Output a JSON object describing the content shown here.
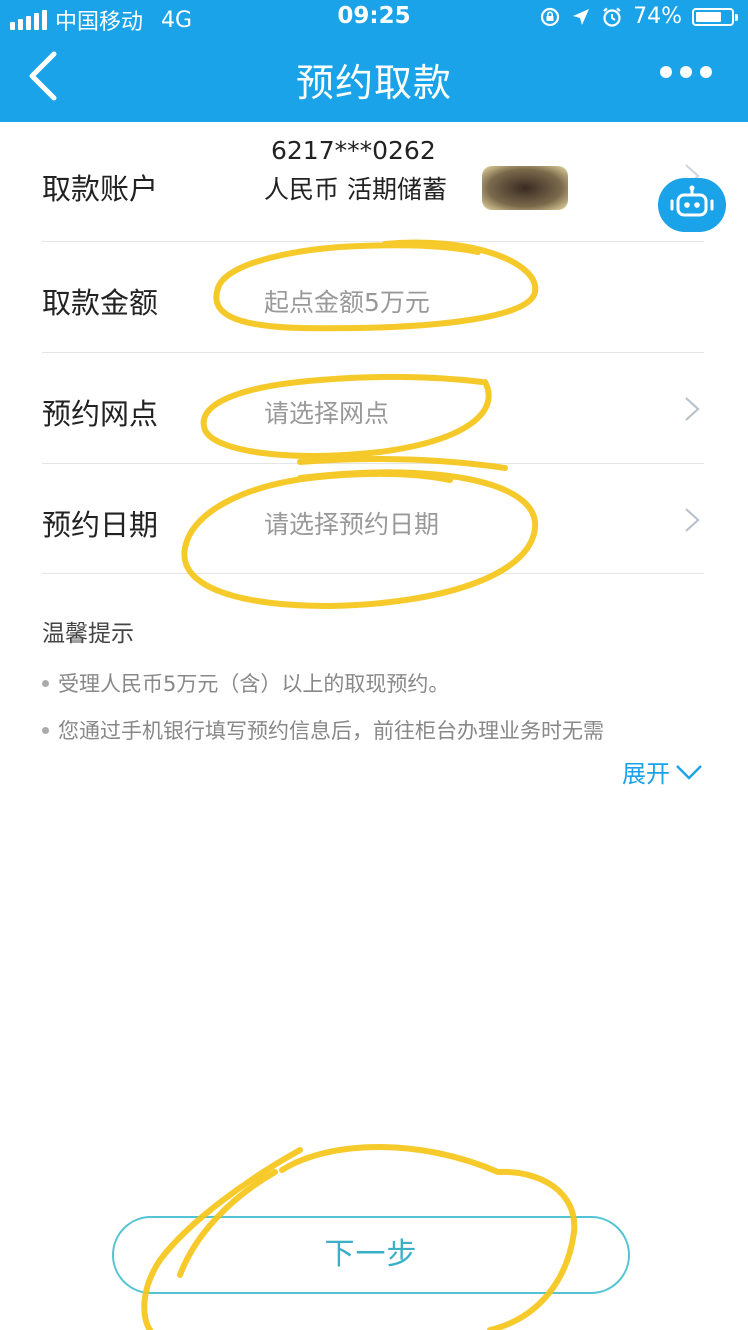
{
  "status_bar": {
    "carrier": "中国移动",
    "network": "4G",
    "time": "09:25",
    "battery": "74%",
    "battery_level": 0.74
  },
  "nav": {
    "title": "预约取款"
  },
  "form": {
    "account": {
      "label": "取款账户",
      "number": "6217***0262",
      "type": "人民币 活期储蓄"
    },
    "amount": {
      "label": "取款金额",
      "placeholder": "起点金额5万元"
    },
    "branch": {
      "label": "预约网点",
      "placeholder": "请选择网点"
    },
    "date": {
      "label": "预约日期",
      "placeholder": "请选择预约日期"
    }
  },
  "tips": {
    "title": "温馨提示",
    "items": [
      "受理人民币5万元（含）以上的取现预约。",
      "您通过手机银行填写预约信息后，前往柜台办理业务时无需"
    ],
    "expand_label": "展开"
  },
  "footer": {
    "next_label": "下一步"
  },
  "colors": {
    "header": "#1aa3e8",
    "accent": "#1aa3e8",
    "button_border": "#52c4d4",
    "highlight_marker": "#f5c518"
  }
}
